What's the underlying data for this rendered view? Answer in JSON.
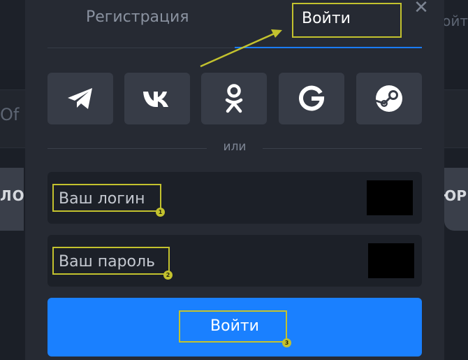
{
  "background": {
    "left_text_1": "Of I",
    "left_text_2": "ЛОБ",
    "right_text_1": "ойт",
    "right_text_2": "ЮР"
  },
  "modal": {
    "close_glyph": "✕",
    "tabs": [
      {
        "label": "Регистрация",
        "active": false
      },
      {
        "label": "Войти",
        "active": true
      }
    ],
    "socials": [
      {
        "name": "telegram-icon"
      },
      {
        "name": "vk-icon"
      },
      {
        "name": "odnoklassniki-icon"
      },
      {
        "name": "google-icon"
      },
      {
        "name": "steam-icon"
      }
    ],
    "divider_text": "или",
    "login": {
      "placeholder": "Ваш логин",
      "value": "",
      "marker": "1"
    },
    "password": {
      "placeholder": "Ваш пароль",
      "value": "",
      "marker": "2"
    },
    "submit": {
      "label": "Войти",
      "marker": "3"
    }
  },
  "colors": {
    "accent": "#1a80ff",
    "highlight": "#c3c22e",
    "panel": "#262a33",
    "social_bg": "#373c47"
  }
}
